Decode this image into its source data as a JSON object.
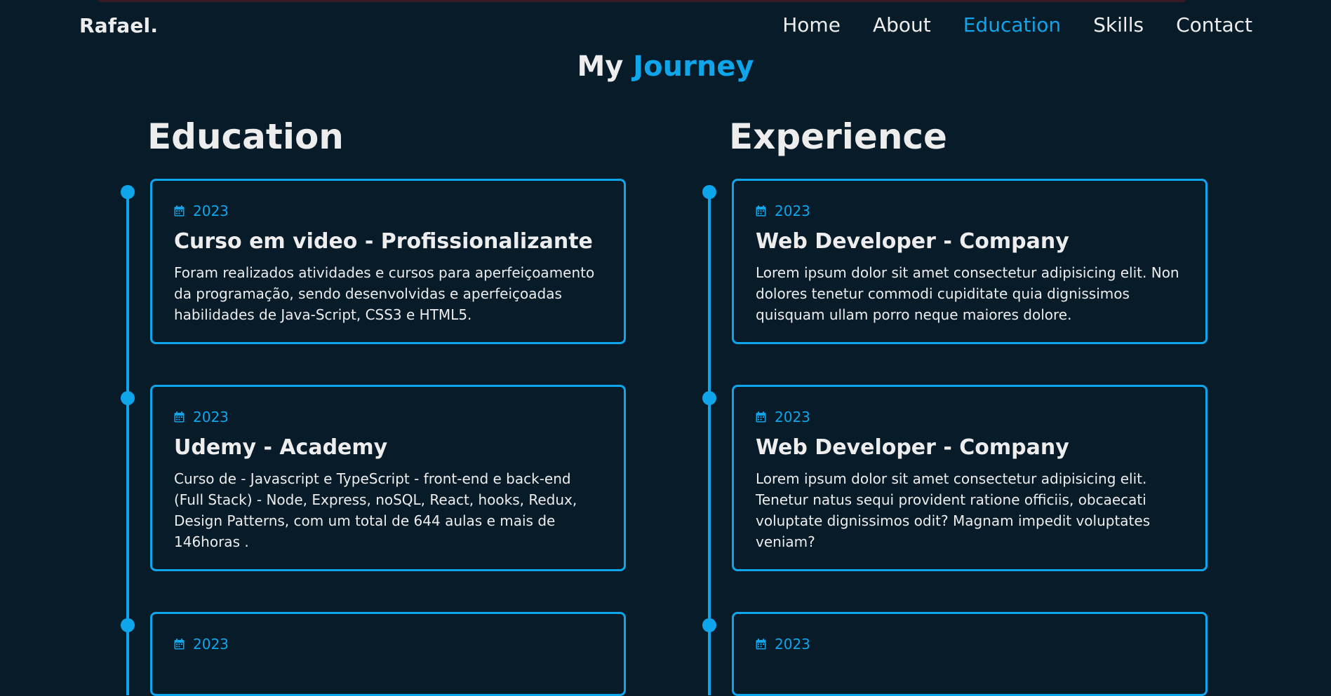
{
  "header": {
    "logo": "Rafael.",
    "nav": [
      "Home",
      "About",
      "Education",
      "Skills",
      "Contact"
    ],
    "active": "Education"
  },
  "page_title": {
    "part1": "My",
    "part2": "Journey"
  },
  "education": {
    "heading": "Education",
    "items": [
      {
        "year": "2023",
        "title": "Curso em video - Profissionalizante",
        "desc": "Foram realizados atividades e cursos para aperfeiçoamento da programação, sendo desenvolvidas e aperfeiçoadas habilidades de Java-Script, CSS3 e HTML5."
      },
      {
        "year": "2023",
        "title": "Udemy - Academy",
        "desc": "Curso de - Javascript e TypeScript - front-end e back-end (Full Stack) - Node, Express, noSQL, React, hooks, Redux, Design Patterns, com um total de 644 aulas e mais de 146horas ."
      },
      {
        "year": "2023",
        "title": "",
        "desc": ""
      }
    ]
  },
  "experience": {
    "heading": "Experience",
    "items": [
      {
        "year": "2023",
        "title": "Web Developer - Company",
        "desc": "Lorem ipsum dolor sit amet consectetur adipisicing elit. Non dolores tenetur commodi cupiditate quia dignissimos quisquam ullam porro neque maiores dolore."
      },
      {
        "year": "2023",
        "title": "Web Developer - Company",
        "desc": "Lorem ipsum dolor sit amet consectetur adipisicing elit. Tenetur natus sequi provident ratione officiis, obcaecati voluptate dignissimos odit? Magnam impedit voluptates veniam?"
      },
      {
        "year": "2023",
        "title": "",
        "desc": ""
      }
    ]
  },
  "colors": {
    "background": "#081b29",
    "accent": "#0ea5ea",
    "text": "#ededed"
  }
}
